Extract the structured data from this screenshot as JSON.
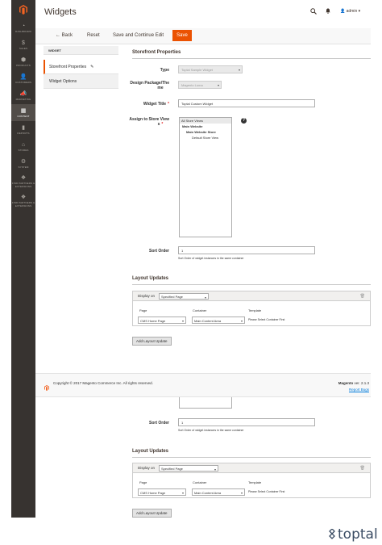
{
  "sidebar": {
    "items": [
      {
        "icon": "dashboard-icon",
        "glyph": "◔",
        "label": "Dashboard"
      },
      {
        "icon": "sales-icon",
        "glyph": "$",
        "label": "Sales"
      },
      {
        "icon": "products-icon",
        "glyph": "⬢",
        "label": "Products"
      },
      {
        "icon": "customers-icon",
        "glyph": "👤",
        "label": "Customers"
      },
      {
        "icon": "marketing-icon",
        "glyph": "📣",
        "label": "Marketing"
      },
      {
        "icon": "content-icon",
        "glyph": "▦",
        "label": "Content"
      },
      {
        "icon": "reports-icon",
        "glyph": "▮",
        "label": "Reports"
      },
      {
        "icon": "stores-icon",
        "glyph": "⌂",
        "label": "Stores"
      },
      {
        "icon": "system-icon",
        "glyph": "⚙",
        "label": "System"
      },
      {
        "icon": "partners-icon",
        "glyph": "❖",
        "label": "Find Partners & Extensions"
      },
      {
        "icon": "partners-icon-2",
        "glyph": "❖",
        "label": "Find Partners & Extensions"
      }
    ]
  },
  "header": {
    "title": "Widgets",
    "user": "admin"
  },
  "actions": {
    "back": "Back",
    "reset": "Reset",
    "save_continue": "Save and Continue Edit",
    "save": "Save"
  },
  "tabs": {
    "heading": "Widget",
    "items": [
      "Storefront Properties",
      "Widget Options"
    ]
  },
  "form": {
    "section": "Storefront Properties",
    "type_label": "Type",
    "type_value": "Toptal Sample Widget",
    "design_label_1": "Design Package/The",
    "design_label_2": "me",
    "design_value": "Magento Luma",
    "title_label": "Widget Title",
    "title_value": "Toptal Custom Widget",
    "stores_label_1": "Assign to Store View",
    "stores_label_2": "s",
    "stores": [
      "All Store Views",
      "Main Website",
      "Main Website Store",
      "Default Store View"
    ],
    "sort_label": "Sort Order",
    "sort_value": "1",
    "sort_note": "Sort Order of widget instances in the same container"
  },
  "layout": {
    "section": "Layout Updates",
    "display_on": "Display on",
    "display_value": "Specified Page",
    "page_h": "Page",
    "container_h": "Container",
    "template_h": "Template",
    "page_value": "CMS Home Page",
    "container_value": "Main Content Area",
    "template_value": "Please Select Container First",
    "add_button": "Add Layout Update"
  },
  "footer": {
    "copyright": "Copyright © 2017 Magento Commerce Inc. All rights reserved.",
    "brand": "Magento",
    "version": " ver. 2.1.3",
    "bugs": "Report Bugs"
  },
  "watermark": "toptal",
  "colors": {
    "accent": "#eb5202",
    "sidebar": "#373330",
    "link": "#007bdb"
  }
}
